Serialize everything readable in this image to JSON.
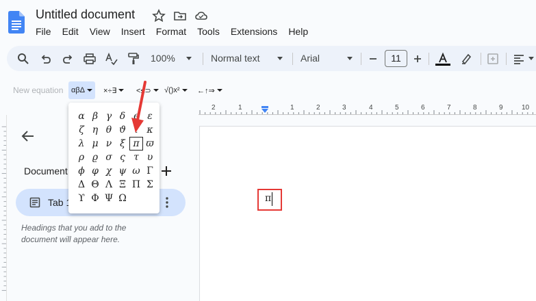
{
  "header": {
    "title": "Untitled document",
    "menu": [
      "File",
      "Edit",
      "View",
      "Insert",
      "Format",
      "Tools",
      "Extensions",
      "Help"
    ]
  },
  "toolbar": {
    "zoom": "100%",
    "style": "Normal text",
    "font": "Arial",
    "font_size": "11"
  },
  "equation_toolbar": {
    "new_equation": "New equation",
    "greek_label": "αβΔ",
    "operations_label": "×÷∃",
    "relations_label": "<≤⊃",
    "math_label": "√()x²",
    "arrows_label": "←↑⇒"
  },
  "ruler": {
    "numbers": [
      "2",
      "1",
      "1",
      "2",
      "3",
      "4",
      "5",
      "6",
      "7",
      "8",
      "9",
      "10"
    ]
  },
  "sidebar": {
    "doc_tabs_label": "Document tabs",
    "tab_label": "Tab 1",
    "headings_hint": "Headings that you add to the document will appear here."
  },
  "document": {
    "inserted_symbol": "π"
  },
  "greek_menu": {
    "rows": [
      [
        "α",
        "β",
        "γ",
        "δ",
        "ϵ",
        "ε"
      ],
      [
        "ζ",
        "η",
        "θ",
        "ϑ",
        "ι",
        "κ"
      ],
      [
        "λ",
        "μ",
        "ν",
        "ξ",
        "π",
        "ϖ"
      ],
      [
        "ρ",
        "ϱ",
        "σ",
        "ς",
        "τ",
        "υ"
      ],
      [
        "ϕ",
        "φ",
        "χ",
        "ψ",
        "ω",
        "Γ"
      ],
      [
        "Δ",
        "Θ",
        "Λ",
        "Ξ",
        "Π",
        "Σ"
      ],
      [
        "ϒ",
        "Φ",
        "Ψ",
        "Ω"
      ]
    ],
    "selected": "π"
  },
  "colors": {
    "accent": "#d3e3fd",
    "toolbar_bg": "#edf2fa",
    "annotation_red": "#e53935"
  }
}
